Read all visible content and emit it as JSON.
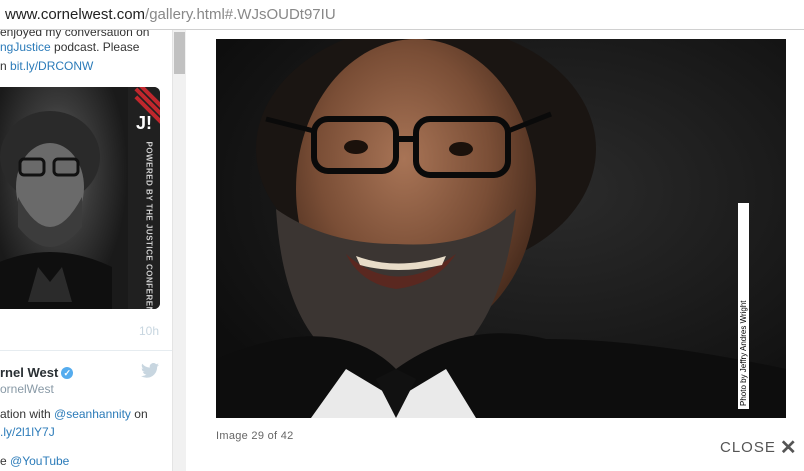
{
  "browser": {
    "url_host": "www.cornelwest.com",
    "url_rest": "/gallery.html#.WJsOUDt97IU"
  },
  "twitter": {
    "line1": "enjoyed my conversation on",
    "line2_link": "ngJustice",
    "line2_text": " podcast. Please",
    "line3_prefix": "n ",
    "line3_link": "bit.ly/DRCONW",
    "card_logo": "J!",
    "card_vertical": "POWERED BY THE JUSTICE CONFERENCE",
    "time": "10h",
    "name": "rnel West",
    "verified": "✓",
    "handle": "ornelWest",
    "text1_prefix": "ation with ",
    "text1_link": "@seanhannity",
    "text1_suffix": " on",
    "text2_link": ".ly/2l1lY7J",
    "text3_prefix": "e ",
    "text3_link": "@YouTube"
  },
  "gallery": {
    "caption": "Image 29 of 42",
    "credit": "Photo by Jeffry Andres Wright",
    "close_label": "CLOSE",
    "close_icon": "✕"
  }
}
